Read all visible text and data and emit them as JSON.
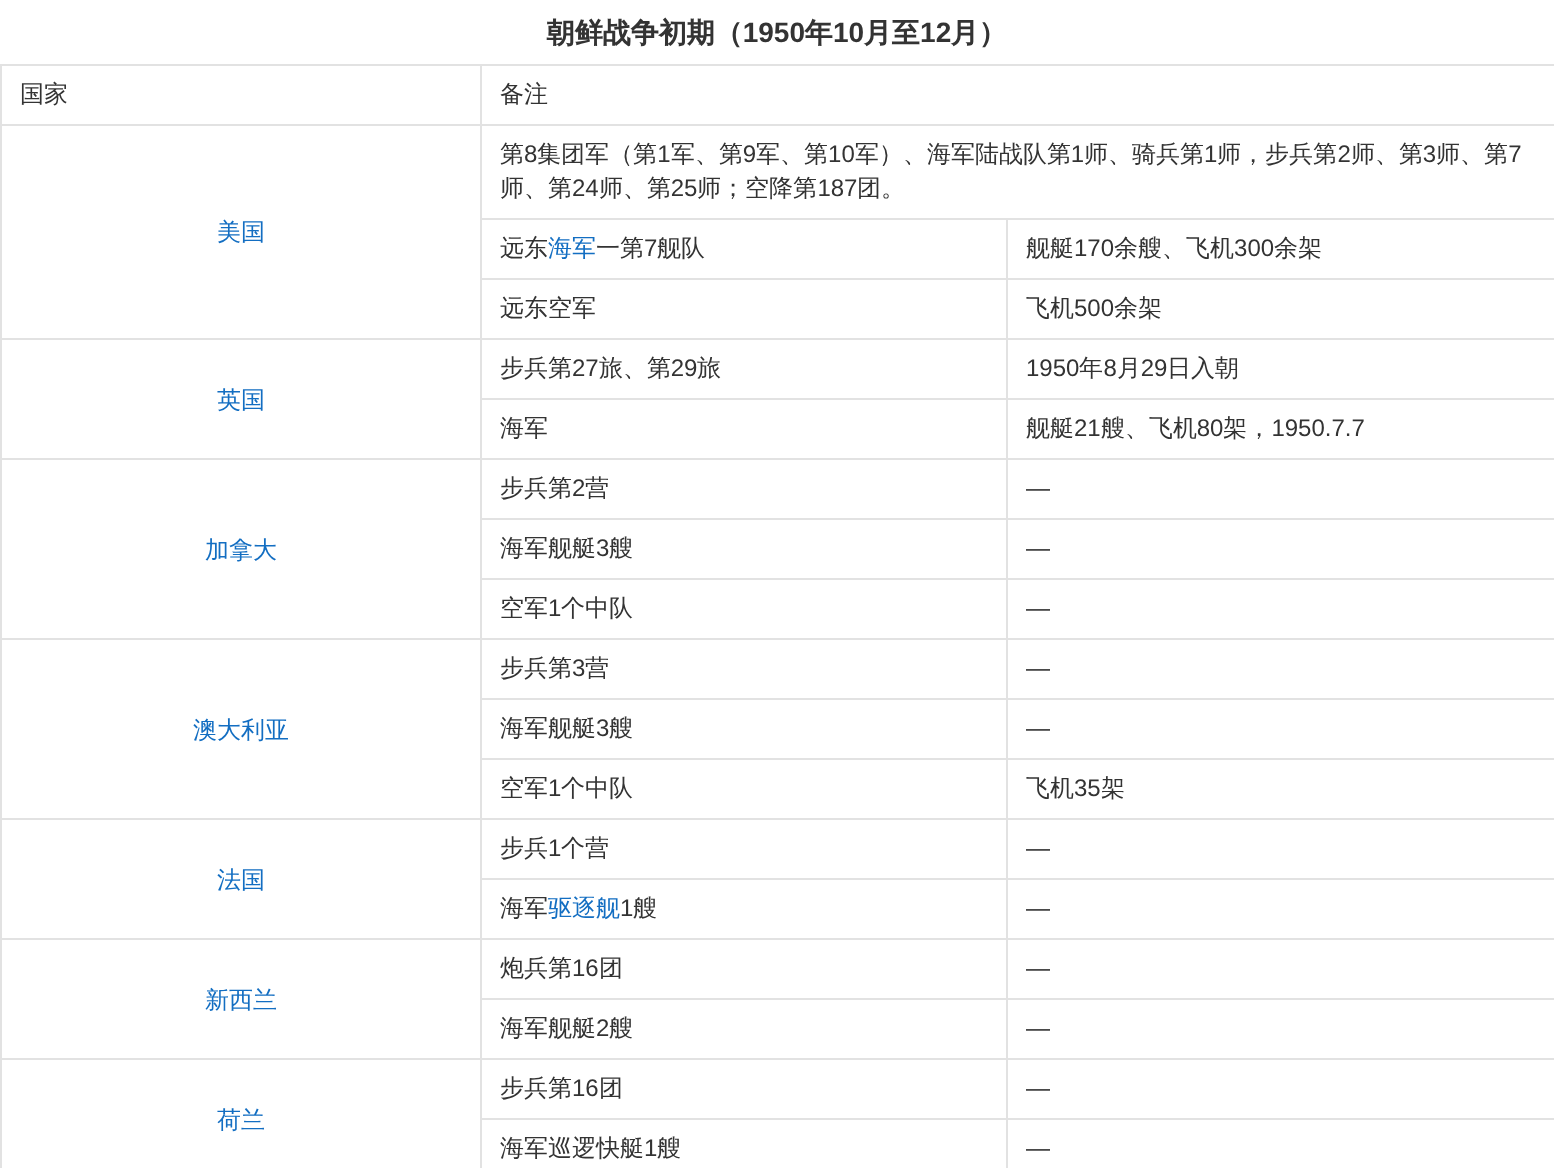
{
  "title": "朝鲜战争初期（1950年10月至12月）",
  "columns": [
    "国家",
    "备注"
  ],
  "countries": [
    {
      "name": "美国",
      "summary": "第8集团军（第1军、第9军、第10军）、海军陆战队第1师、骑兵第1师，步兵第2师、第3师、第7师、第24师、第25师；空降第187团。",
      "rows": [
        {
          "unit": {
            "segments": [
              {
                "text": "远东",
                "link": false
              },
              {
                "text": "海军",
                "link": true
              },
              {
                "text": "一第7舰队",
                "link": false
              }
            ]
          },
          "note": "舰艇170余艘、飞机300余架"
        },
        {
          "unit": "远东空军",
          "note": "飞机500余架"
        }
      ]
    },
    {
      "name": "英国",
      "rows": [
        {
          "unit": "步兵第27旅、第29旅",
          "note": "1950年8月29日入朝"
        },
        {
          "unit": "海军",
          "note": "舰艇21艘、飞机80架，1950.7.7"
        }
      ]
    },
    {
      "name": "加拿大",
      "rows": [
        {
          "unit": "步兵第2营",
          "note": "—"
        },
        {
          "unit": "海军舰艇3艘",
          "note": "—"
        },
        {
          "unit": "空军1个中队",
          "note": "—"
        }
      ]
    },
    {
      "name": "澳大利亚",
      "rows": [
        {
          "unit": "步兵第3营",
          "note": "—"
        },
        {
          "unit": "海军舰艇3艘",
          "note": "—"
        },
        {
          "unit": "空军1个中队",
          "note": "飞机35架"
        }
      ]
    },
    {
      "name": "法国",
      "rows": [
        {
          "unit": "步兵1个营",
          "note": "—"
        },
        {
          "unit": {
            "segments": [
              {
                "text": "海军",
                "link": false
              },
              {
                "text": "驱逐舰",
                "link": true
              },
              {
                "text": "1艘",
                "link": false
              }
            ]
          },
          "note": "—"
        }
      ]
    },
    {
      "name": "新西兰",
      "rows": [
        {
          "unit": "炮兵第16团",
          "note": "—"
        },
        {
          "unit": "海军舰艇2艘",
          "note": "—"
        }
      ]
    },
    {
      "name": "荷兰",
      "rows": [
        {
          "unit": "步兵第16团",
          "note": "—"
        },
        {
          "unit": "海军巡逻快艇1艘",
          "note": "—"
        }
      ]
    }
  ]
}
